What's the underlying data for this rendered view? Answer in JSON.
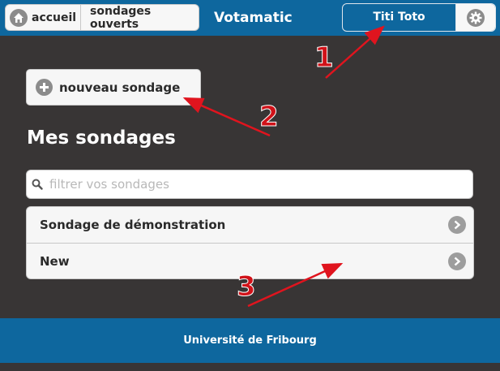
{
  "header": {
    "nav_accueil": "accueil",
    "nav_ouverts": "sondages ouverts",
    "app_title": "Votamatic",
    "user_name": "Titi Toto"
  },
  "main": {
    "new_poll_label": "nouveau sondage",
    "page_title": "Mes sondages",
    "search_placeholder": "filtrer vos sondages",
    "polls": [
      {
        "label": "Sondage de démonstration"
      },
      {
        "label": "New"
      }
    ]
  },
  "footer": {
    "text": "Université de Fribourg"
  },
  "annotations": {
    "one": "1",
    "two": "2",
    "three": "3"
  },
  "colors": {
    "header": "#0e679e",
    "background": "#383535",
    "arrow": "#e0141e"
  }
}
